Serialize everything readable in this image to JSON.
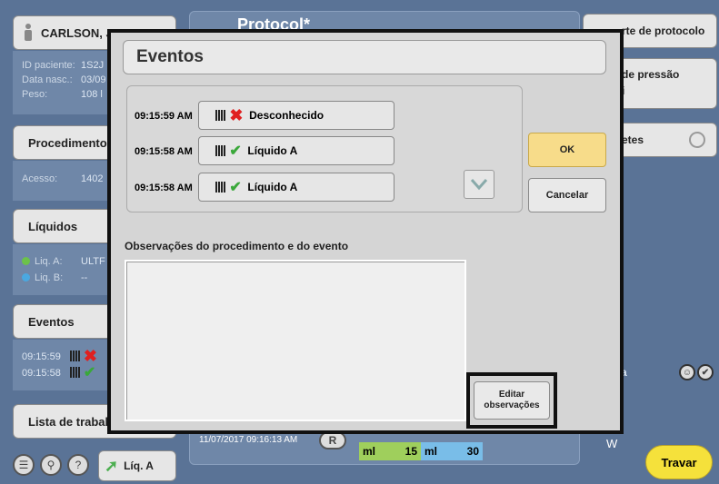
{
  "patient": {
    "name": "CARLSON, JO",
    "fields": [
      {
        "label": "ID paciente:",
        "value": "1S2J"
      },
      {
        "label": "Data nasc.:",
        "value": "03/09"
      },
      {
        "label": "Peso:",
        "value": "108 l"
      }
    ]
  },
  "procedure": {
    "title": "Procedimento",
    "access_label": "Acesso:",
    "access_value": "1402"
  },
  "liquids": {
    "title": "Líquidos",
    "items": [
      {
        "label": "Liq. A:",
        "value": "ULTF",
        "color": "#6cc24a"
      },
      {
        "label": "Liq. B:",
        "value": "--",
        "color": "#4aa8e0"
      }
    ]
  },
  "events_panel": {
    "title": "Eventos",
    "items": [
      {
        "time": "09:15:59",
        "icon": "x-icon"
      },
      {
        "time": "09:15:58",
        "icon": "check-icon"
      }
    ]
  },
  "worklist": {
    "label": "Lista de trabalho"
  },
  "bottom_left": {
    "liq_button": "Líq. A"
  },
  "protocol": {
    "title_fragment": "Protocol*",
    "timestamp": "11/07/2017 09:16:13 AM",
    "r_label": "R",
    "vol1_unit": "ml",
    "vol1_value": "15",
    "vol2_unit": "ml",
    "vol2_value": "30"
  },
  "right_panel": {
    "protocol_button": "rte de protocolo",
    "pressure_label": "de pressão",
    "pressure_sub": "i",
    "item3": "etes",
    "item4": "a",
    "travar": "Travar",
    "w_mark": "W"
  },
  "dialog": {
    "title": "Eventos",
    "events": [
      {
        "time": "09:15:59 AM",
        "icon": "x-icon",
        "label": "Desconhecido"
      },
      {
        "time": "09:15:58 AM",
        "icon": "check-icon",
        "label": "Líquido A"
      },
      {
        "time": "09:15:58 AM",
        "icon": "check-icon",
        "label": "Líquido A"
      }
    ],
    "ok_label": "OK",
    "cancel_label": "Cancelar",
    "notes_label": "Observações do procedimento e do evento",
    "notes_value": "",
    "edit_notes_line1": "Editar",
    "edit_notes_line2": "observações",
    "ok_color": "#f7dc8a"
  }
}
